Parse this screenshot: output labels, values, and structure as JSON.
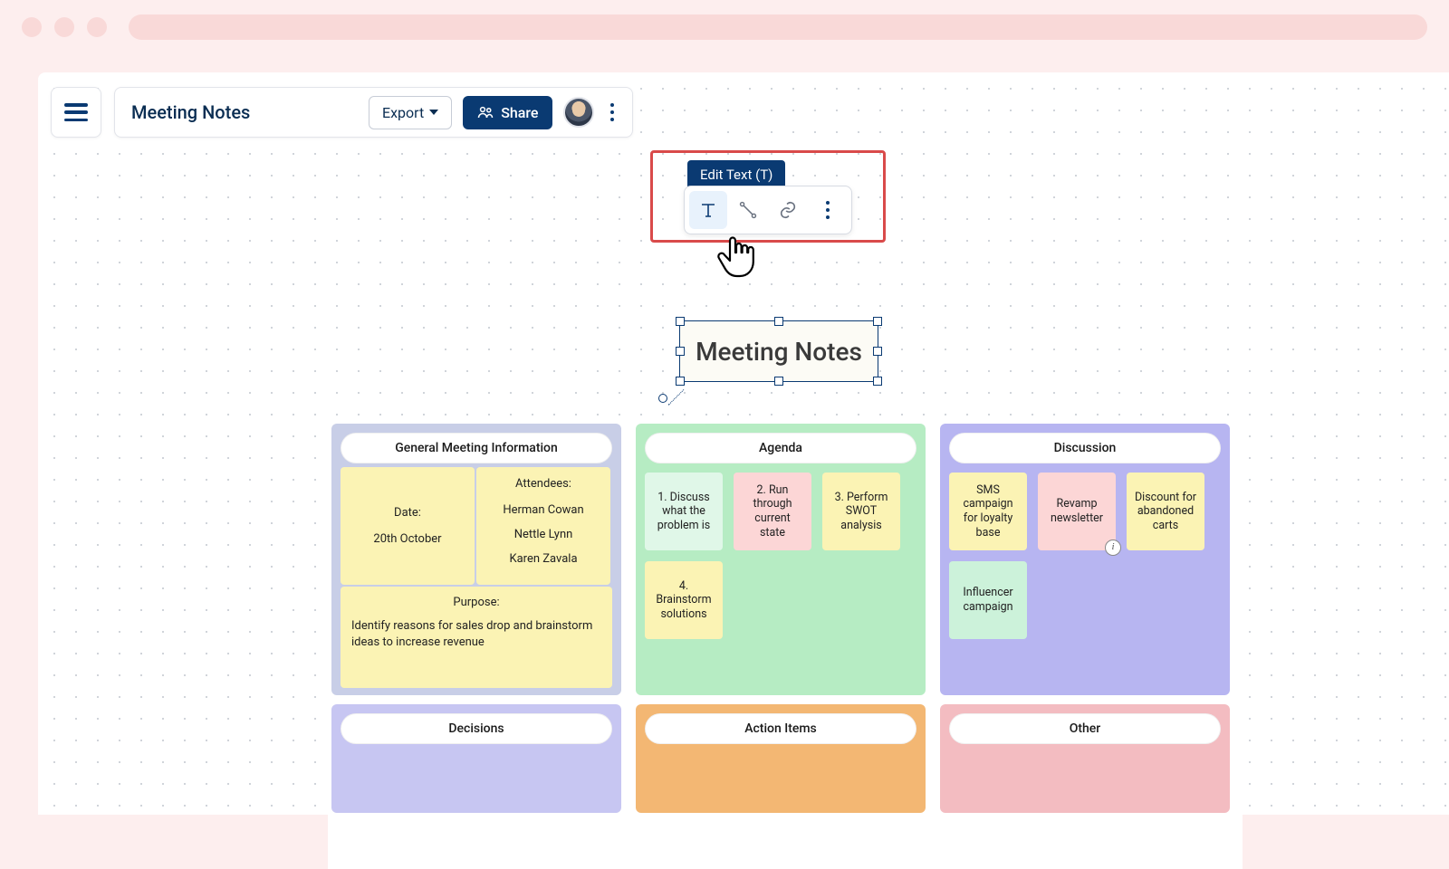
{
  "header": {
    "title": "Meeting Notes",
    "export_label": "Export",
    "share_label": "Share"
  },
  "context_toolbar": {
    "tooltip": "Edit Text (T)"
  },
  "selected_node": {
    "text": "Meeting Notes"
  },
  "sections": {
    "info": {
      "title": "General Meeting Information",
      "date_label": "Date:",
      "date_value": "20th October",
      "attendees_label": "Attendees:",
      "attendees": [
        "Herman Cowan",
        "Nettle Lynn",
        "Karen Zavala"
      ],
      "purpose_label": "Purpose:",
      "purpose_text": "Identify reasons for sales drop and brainstorm ideas to increase revenue"
    },
    "agenda": {
      "title": "Agenda",
      "items": [
        "1. Discuss what the problem is",
        "2. Run through current state",
        "3. Perform SWOT analysis",
        "4. Brainstorm solutions"
      ]
    },
    "discussion": {
      "title": "Discussion",
      "items": [
        "SMS campaign for loyalty base",
        "Revamp newsletter",
        "Discount for abandoned carts",
        "Influencer campaign"
      ]
    },
    "decisions": {
      "title": "Decisions"
    },
    "action_items": {
      "title": "Action Items"
    },
    "other": {
      "title": "Other"
    }
  }
}
